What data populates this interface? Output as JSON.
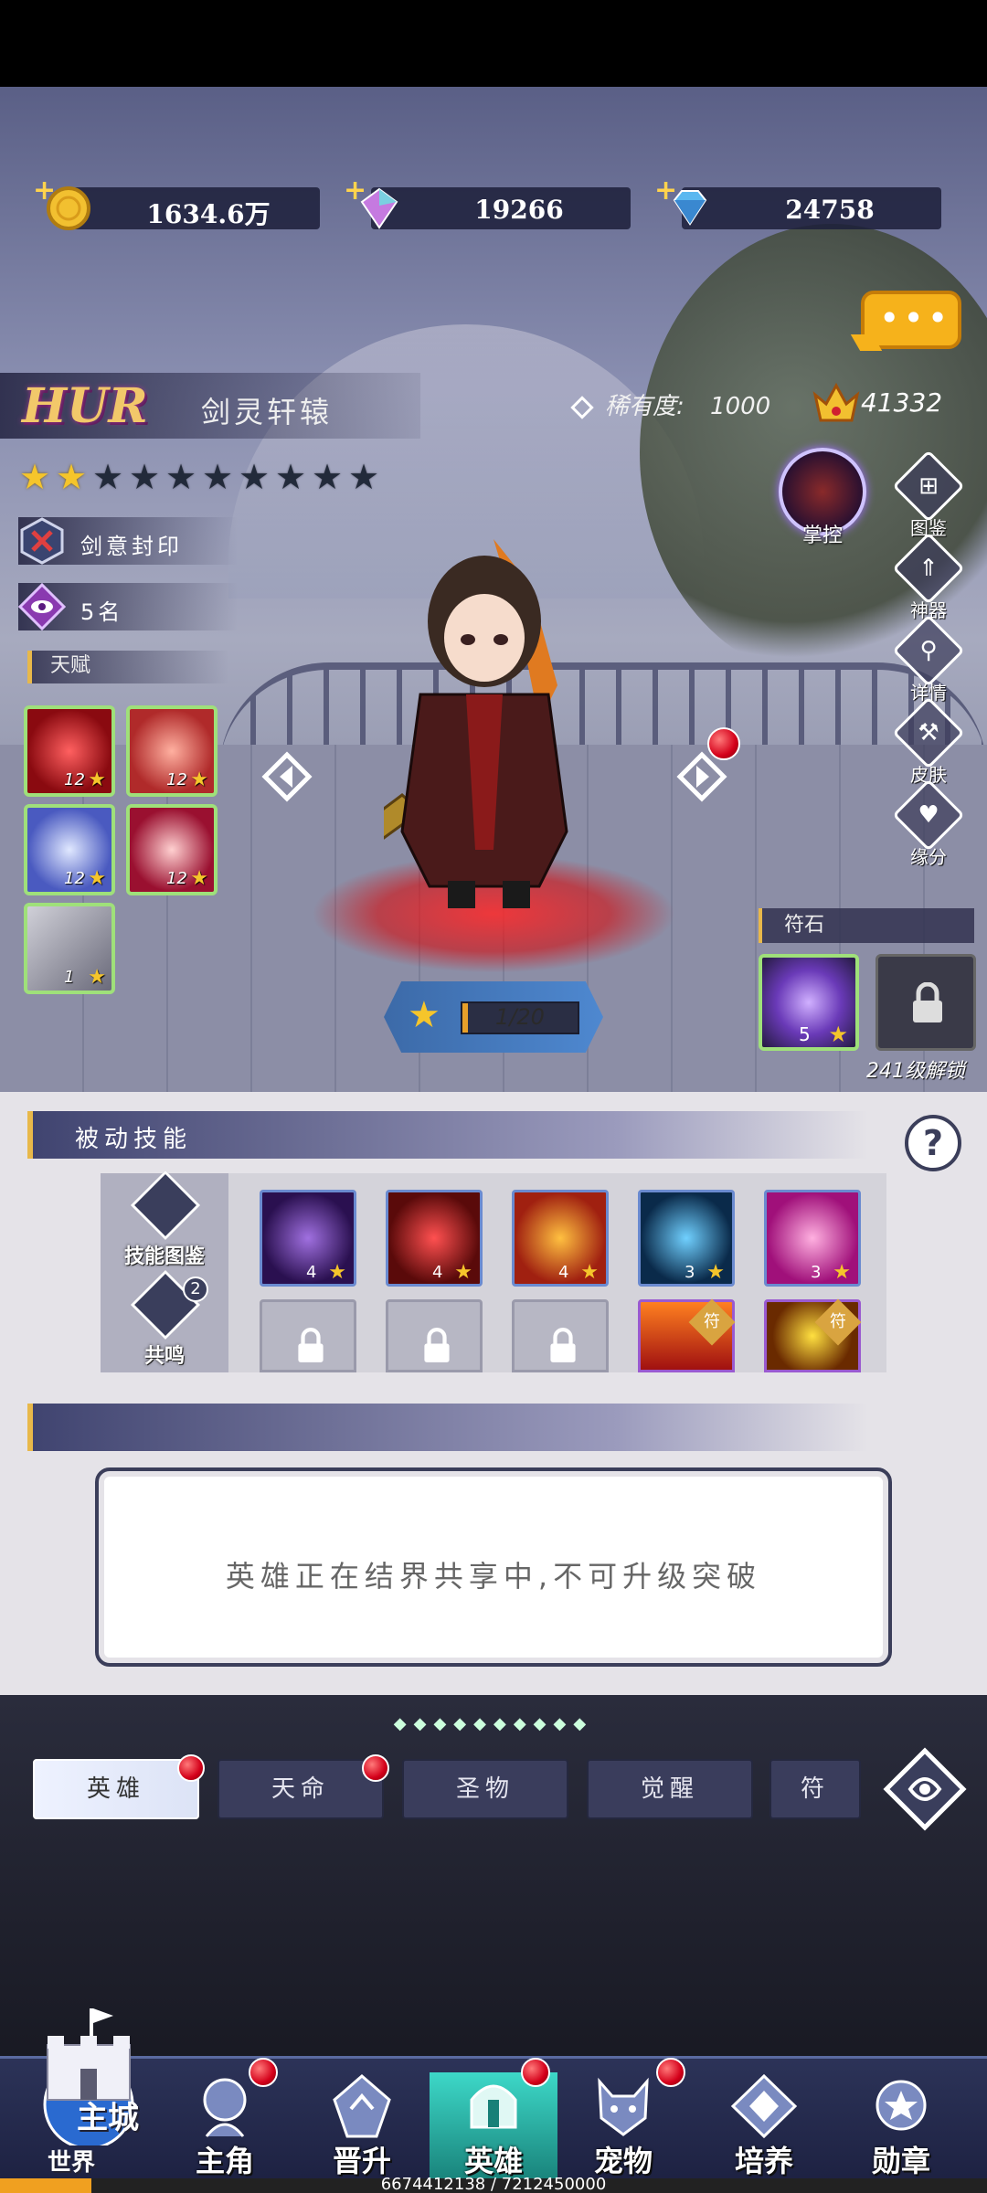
{
  "currency": [
    {
      "icon": "gold-coin-icon",
      "value": "1634.6万"
    },
    {
      "icon": "rainbow-gem-icon",
      "value": "19266"
    },
    {
      "icon": "blue-diamond-icon",
      "value": "24758"
    }
  ],
  "hero": {
    "rank": "HUR",
    "name": "剑灵轩辕",
    "rarity_label": "稀有度:",
    "rarity_value": "1000",
    "power": "41332",
    "stars_lit": 2,
    "stars_total": 10,
    "seal": "剑意封印",
    "rank_place": "5名",
    "talent_title": "天赋",
    "talent_skills": [
      {
        "level": "12",
        "color": "#c0202a"
      },
      {
        "level": "12",
        "color": "#d84a4a"
      },
      {
        "level": "12",
        "color": "#5a6ad0"
      },
      {
        "level": "12",
        "color": "#b02040"
      },
      {
        "level": "1",
        "color": "#8a8a9a"
      }
    ],
    "exp": "1/20",
    "exp_fraction": 0.05,
    "control_label": "掌控"
  },
  "right_menu": [
    {
      "icon": "book-icon",
      "label": "图鉴"
    },
    {
      "icon": "artifact-icon",
      "label": "神器"
    },
    {
      "icon": "magnify-icon",
      "label": "详情"
    },
    {
      "icon": "shirt-icon",
      "label": "皮肤"
    },
    {
      "icon": "heart-icon",
      "label": "缘分"
    }
  ],
  "rune": {
    "title": "符石",
    "level": "5",
    "unlock_text": "241级解锁"
  },
  "passive": {
    "title": "被动技能",
    "side_buttons": [
      "技能图鉴",
      "共鸣"
    ],
    "resonance_badge": "2",
    "skills": [
      {
        "level": "4",
        "color": "#5a2a9a"
      },
      {
        "level": "4",
        "color": "#8a1a1a"
      },
      {
        "level": "4",
        "color": "#c04a10"
      },
      {
        "level": "3",
        "color": "#1a5a8a"
      },
      {
        "level": "3",
        "color": "#c0309a"
      }
    ],
    "second_row_badge": "符"
  },
  "message": "英雄正在结界共享中,不可升级突破",
  "tabs": [
    "英雄",
    "天命",
    "圣物",
    "觉醒",
    "符"
  ],
  "nav": {
    "city_top": "主城",
    "city_bottom": "世界",
    "items": [
      "主角",
      "晋升",
      "英雄",
      "宠物",
      "培养",
      "勋章"
    ]
  },
  "progress": {
    "text": "6674412138 / 7212450000",
    "fraction": 0.0925
  },
  "colors": {
    "accent_gold": "#f5c52b",
    "dot_red": "#d4001a",
    "nav_active": "#3dd8c8"
  }
}
